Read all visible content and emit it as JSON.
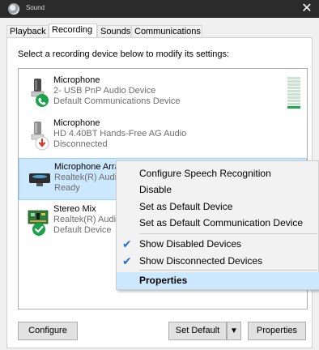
{
  "window": {
    "title": "Sound",
    "close_glyph": "✕"
  },
  "tabs": [
    {
      "label": "Playback"
    },
    {
      "label": "Recording"
    },
    {
      "label": "Sounds"
    },
    {
      "label": "Communications"
    }
  ],
  "instruction": "Select a recording device below to modify its settings:",
  "devices": [
    {
      "name": "Microphone",
      "driver": "2- USB PnP Audio Device",
      "status": "Default Communications Device",
      "icon": "usb-microphone-icon",
      "badge": "phone-badge-icon",
      "level_bars_on": 1,
      "level_bars_total": 10
    },
    {
      "name": "Microphone",
      "driver": "HD 4.40BT Hands-Free AG Audio",
      "status": "Disconnected",
      "icon": "headset-microphone-icon",
      "badge": "disconnected-badge-icon"
    },
    {
      "name": "Microphone Array",
      "driver": "Realtek(R) Audio",
      "status": "Ready",
      "icon": "microphone-array-icon",
      "level_bars_on": 0,
      "level_bars_total": 10
    },
    {
      "name": "Stereo Mix",
      "driver": "Realtek(R) Audio",
      "status": "Default Device",
      "icon": "stereo-mix-board-icon",
      "badge": "default-check-badge-icon"
    }
  ],
  "context_menu": {
    "items": [
      {
        "label": "Configure Speech Recognition"
      },
      {
        "label": "Disable"
      },
      {
        "label": "Set as Default Device"
      },
      {
        "label": "Set as Default Communication Device"
      },
      {
        "label": "Show Disabled Devices",
        "checked": true
      },
      {
        "label": "Show Disconnected Devices",
        "checked": true
      },
      {
        "label": "Properties",
        "bold": true
      }
    ],
    "check_glyph": "✔"
  },
  "buttons": {
    "configure": "Configure",
    "set_default": "Set Default",
    "set_default_arrow": "▼",
    "properties": "Properties"
  },
  "colors": {
    "selection": "#cce8ff",
    "titlebar": "#2b2b2b",
    "level_on": "#1fa84d",
    "badge_green": "#1aa14b",
    "badge_red": "#d83b2b"
  }
}
